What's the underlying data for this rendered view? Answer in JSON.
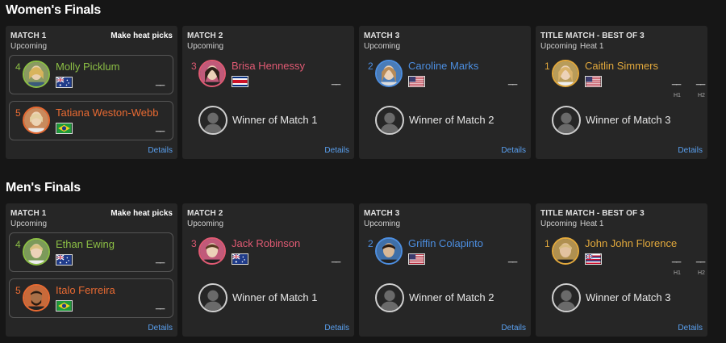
{
  "colors": {
    "seed1": "#e3a93c",
    "seed2": "#4c8ee0",
    "seed3": "#e05a73",
    "seed4": "#8cbf45",
    "seed5": "#e86a32",
    "details": "#5aa0f0",
    "background": "#161616",
    "card": "#262626"
  },
  "sections": [
    {
      "title": "Women's Finals",
      "cards": [
        {
          "title": "MATCH 1",
          "status": "Upcoming",
          "heat_picks": "Make heat picks",
          "details": "Details",
          "athletes": [
            {
              "seed": "4",
              "name": "Molly Picklum",
              "flag": "AUS",
              "score": "__"
            },
            {
              "seed": "5",
              "name": "Tatiana Weston-Webb",
              "flag": "BRA",
              "score": "__"
            }
          ]
        },
        {
          "title": "MATCH 2",
          "status": "Upcoming",
          "details": "Details",
          "athlete": {
            "seed": "3",
            "name": "Brisa Hennessy",
            "flag": "CRC",
            "score": "__"
          },
          "winner": "Winner of Match 1"
        },
        {
          "title": "MATCH 3",
          "status": "Upcoming",
          "details": "Details",
          "athlete": {
            "seed": "2",
            "name": "Caroline Marks",
            "flag": "USA",
            "score": "__"
          },
          "winner": "Winner of Match 2"
        },
        {
          "title": "TITLE MATCH - BEST OF 3",
          "status": "Upcoming",
          "heat": "Heat 1",
          "details": "Details",
          "athlete": {
            "seed": "1",
            "name": "Caitlin Simmers",
            "flag": "USA",
            "h1": "__",
            "h2": "__"
          },
          "h_labels": [
            "H1",
            "H2"
          ],
          "winner": "Winner of Match 3"
        }
      ]
    },
    {
      "title": "Men's Finals",
      "cards": [
        {
          "title": "MATCH 1",
          "status": "Upcoming",
          "heat_picks": "Make heat picks",
          "details": "Details",
          "athletes": [
            {
              "seed": "4",
              "name": "Ethan Ewing",
              "flag": "AUS",
              "score": "__"
            },
            {
              "seed": "5",
              "name": "Italo Ferreira",
              "flag": "BRA",
              "score": "__"
            }
          ]
        },
        {
          "title": "MATCH 2",
          "status": "Upcoming",
          "details": "Details",
          "athlete": {
            "seed": "3",
            "name": "Jack Robinson",
            "flag": "AUS",
            "score": "__"
          },
          "winner": "Winner of Match 1"
        },
        {
          "title": "MATCH 3",
          "status": "Upcoming",
          "details": "Details",
          "athlete": {
            "seed": "2",
            "name": "Griffin Colapinto",
            "flag": "USA",
            "score": "__"
          },
          "winner": "Winner of Match 2"
        },
        {
          "title": "TITLE MATCH - BEST OF 3",
          "status": "Upcoming",
          "heat": "Heat 1",
          "details": "Details",
          "athlete": {
            "seed": "1",
            "name": "John John Florence",
            "flag": "HAW",
            "h1": "__",
            "h2": "__"
          },
          "h_labels": [
            "H1",
            "H2"
          ],
          "winner": "Winner of Match 3"
        }
      ]
    }
  ]
}
